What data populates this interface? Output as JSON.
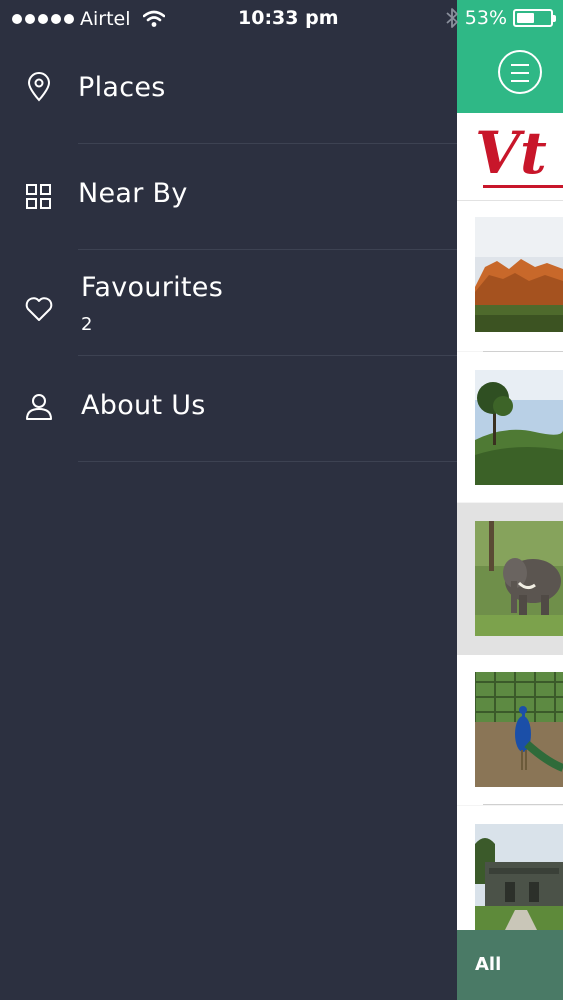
{
  "status_bar": {
    "carrier": "Airtel",
    "time": "10:33 pm",
    "battery_text": "53%",
    "battery_level": 0.53
  },
  "menu": {
    "items": [
      {
        "label": "Places",
        "icon": "location-pin-icon"
      },
      {
        "label": "Near By",
        "icon": "grid-icon"
      },
      {
        "label": "Favourites",
        "icon": "heart-icon",
        "count": "2"
      },
      {
        "label": "About Us",
        "icon": "user-icon"
      }
    ]
  },
  "panel": {
    "logo_text": "Vt",
    "filter_label": "All",
    "accent_color": "#2fb886",
    "brand_color": "#c8162a"
  }
}
